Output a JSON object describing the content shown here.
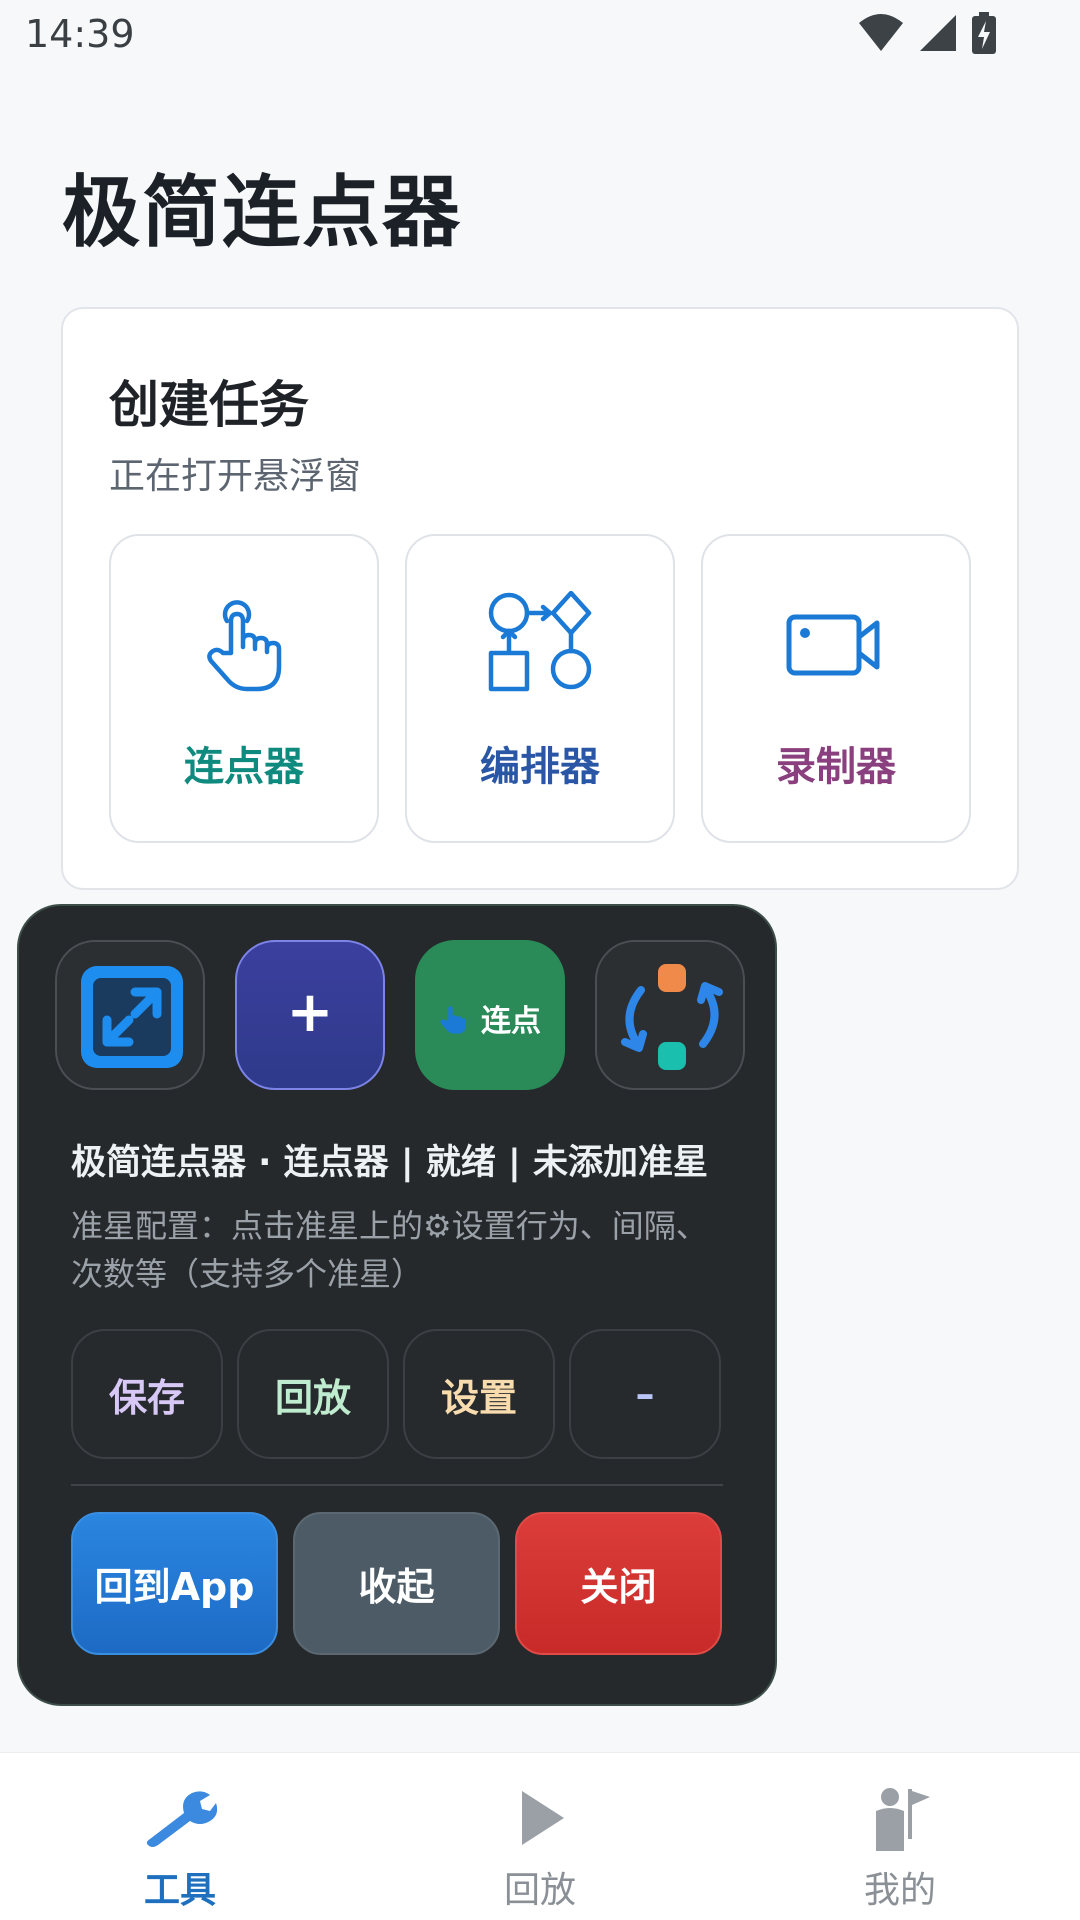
{
  "status_bar": {
    "time": "14:39"
  },
  "app": {
    "title": "极简连点器"
  },
  "create_card": {
    "title": "创建任务",
    "subtitle": "正在打开悬浮窗",
    "modes": [
      {
        "label": "连点器",
        "color": "#0f8a7e",
        "icon": "tap-hand-icon"
      },
      {
        "label": "编排器",
        "color": "#2a56a6",
        "icon": "flowchart-icon"
      },
      {
        "label": "录制器",
        "color": "#8a3f7e",
        "icon": "video-camera-icon"
      }
    ]
  },
  "floating_panel": {
    "tools": [
      {
        "icon": "resize-icon"
      },
      {
        "label": "+",
        "icon": "plus-icon"
      },
      {
        "label": "连点",
        "icon": "tap-hand-icon"
      },
      {
        "icon": "sync-icon"
      }
    ],
    "status_line": "极简连点器 · 连点器 | 就绪 | 未添加准星",
    "hint": "准星配置：点击准星上的⚙设置行为、间隔、次数等（支持多个准星）",
    "small_buttons": [
      {
        "label": "保存",
        "color": "#d8c8f6"
      },
      {
        "label": "回放",
        "color": "#bfeccf"
      },
      {
        "label": "设置",
        "color": "#f8dcae"
      },
      {
        "label": "–",
        "color": "#b9c5f7"
      }
    ],
    "big_buttons": [
      {
        "label": "回到App",
        "color": "#2176d2"
      },
      {
        "label": "收起",
        "color": "#4d5b66"
      },
      {
        "label": "关闭",
        "color": "#d2322f"
      }
    ]
  },
  "bottom_nav": {
    "items": [
      {
        "label": "工具",
        "icon": "wrench-icon",
        "active": true,
        "color": "#1f6fbf"
      },
      {
        "label": "回放",
        "icon": "play-icon",
        "active": false,
        "color": "#8a9096"
      },
      {
        "label": "我的",
        "icon": "person-flag-icon",
        "active": false,
        "color": "#8a9096"
      }
    ]
  }
}
